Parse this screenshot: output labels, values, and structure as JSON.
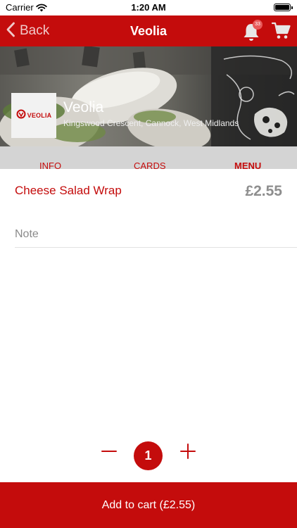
{
  "status_bar": {
    "carrier": "Carrier",
    "time": "1:20 AM",
    "icons": [
      "wifi-icon",
      "battery-icon"
    ]
  },
  "nav": {
    "back_label": "Back",
    "title": "Veolia",
    "notification_count": "33",
    "icons": [
      "chevron-left-icon",
      "bell-icon",
      "cart-icon"
    ]
  },
  "venue": {
    "name": "Veolia",
    "address": "Kingswood Crescent, Cannock, West Midlands",
    "logo_text": "VEOLIA"
  },
  "tabs": [
    {
      "label": "INFO",
      "active": false
    },
    {
      "label": "CARDS",
      "active": false
    },
    {
      "label": "MENU",
      "active": true
    }
  ],
  "item": {
    "name": "Cheese Salad Wrap",
    "price": "£2.55",
    "note_placeholder": "Note",
    "note_value": ""
  },
  "quantity": {
    "count": "1",
    "minus_label": "−",
    "plus_label": "+"
  },
  "cart_button": {
    "label": "Add to cart (£2.55)"
  },
  "colors": {
    "brand": "#c40c0c",
    "price_grey": "#8e8e8e",
    "tab_bar": "#d4d4d4"
  }
}
